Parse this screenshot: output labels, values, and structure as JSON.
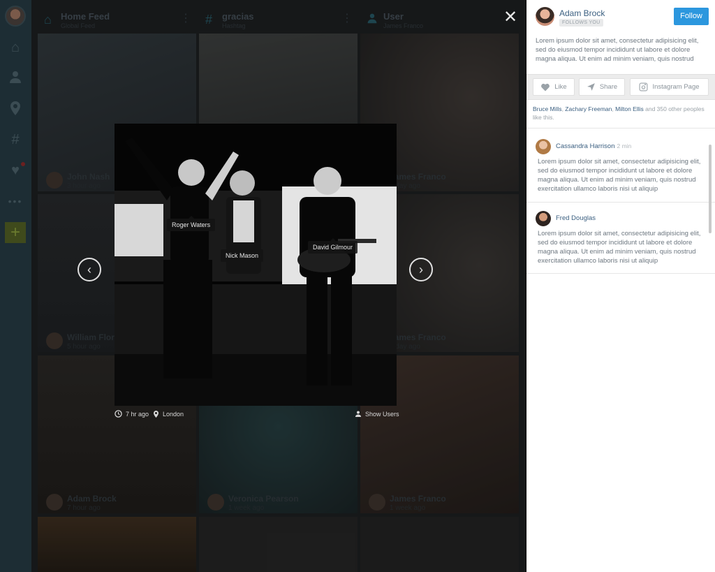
{
  "feed": {
    "columns": [
      {
        "title": "Home Feed",
        "subtitle": "Global Feed"
      },
      {
        "title": "gracias",
        "subtitle": "Hashtag"
      },
      {
        "title": "User",
        "subtitle": "James Franco"
      }
    ],
    "tiles": [
      {
        "name": "John Nash",
        "time": "3 hour ago"
      },
      {
        "name": "James Franco",
        "time": "1 day ago"
      },
      {
        "name": "William Flores",
        "time": "5 hour ago"
      },
      {
        "name": "James Franco",
        "time": "1 day ago"
      },
      {
        "name": "Adam Brock",
        "time": "7 hour ago"
      },
      {
        "name": "Veronica Pearson",
        "time": "1 week ago"
      },
      {
        "name": "James Franco",
        "time": "1 week ago"
      }
    ]
  },
  "modal": {
    "close_label": "✕",
    "tags": [
      "Roger Waters",
      "Nick Mason",
      "David Gilmour"
    ],
    "time": "7 hr ago",
    "location": "London",
    "show_users": "Show Users",
    "prev_label": "‹",
    "next_label": "›"
  },
  "panel": {
    "user_name": "Adam Brock",
    "follows_badge": "FOLLOWS YOU",
    "follow_button": "Follow",
    "bio": "Lorem ipsum dolor sit amet, consectetur adipisicing elit, sed do eiusmod tempor incididunt ut labore et dolore magna aliqua. Ut enim ad minim veniam, quis nostrud",
    "actions": {
      "like": "Like",
      "share": "Share",
      "instagram": "Instagram Page"
    },
    "likes": {
      "users": [
        "Bruce Mills",
        "Zachary Freeman",
        "Milton Ellis"
      ],
      "sep1": ", ",
      "sep2": ", ",
      "rest": " and 350 other peoples like this."
    },
    "comments": [
      {
        "name": "Cassandra Harrison",
        "time": "2 min",
        "text": "Lorem ipsum dolor sit amet, consectetur adipisicing elit, sed do eiusmod tempor incididunt ut labore et dolore magna aliqua. Ut enim ad minim veniam, quis nostrud exercitation ullamco laboris nisi ut aliquip"
      },
      {
        "name": "Fred Douglas",
        "time": "",
        "text": "Lorem ipsum dolor sit amet, consectetur adipisicing elit, sed do eiusmod tempor incididunt ut labore et dolore magna aliqua. Ut enim ad minim veniam, quis nostrud exercitation ullamco laboris nisi ut aliquip"
      }
    ],
    "colors": {
      "accent": "#2c97de",
      "link": "#3b5f80"
    }
  }
}
